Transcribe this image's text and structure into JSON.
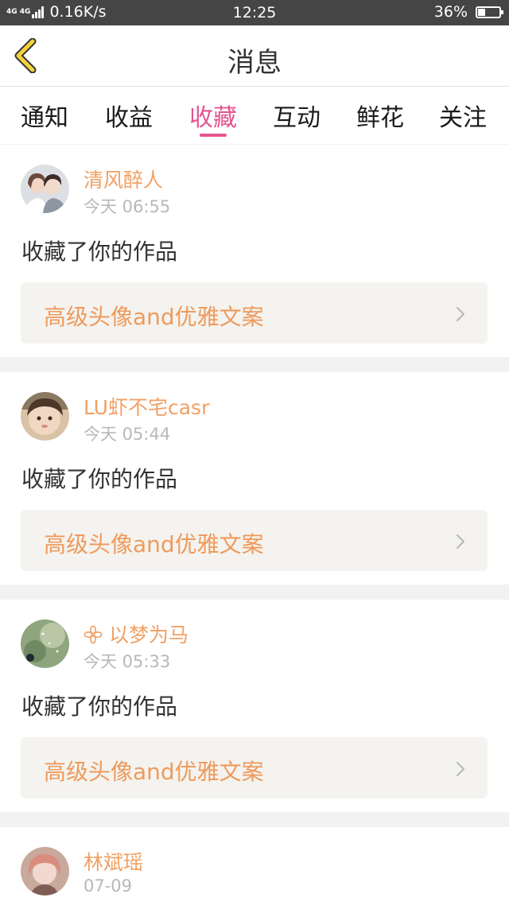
{
  "status_bar": {
    "network": "4G 4G",
    "speed": "0.16K/s",
    "time": "12:25",
    "battery": "36%",
    "battery_level": 0.36
  },
  "header": {
    "title": "消息",
    "back_icon": "chevron-left-icon",
    "accent_color": "#f2d23a"
  },
  "tabs": {
    "items": [
      {
        "label": "通知",
        "active": false
      },
      {
        "label": "收益",
        "active": false
      },
      {
        "label": "收藏",
        "active": true
      },
      {
        "label": "互动",
        "active": false
      },
      {
        "label": "鲜花",
        "active": false
      },
      {
        "label": "关注",
        "active": false
      }
    ],
    "active_color": "#e55591"
  },
  "notifications": [
    {
      "username": "清风醉人",
      "time": "今天 06:55",
      "action": "收藏了你的作品",
      "work_title": "高级头像and优雅文案"
    },
    {
      "username": "LU虾不宅casr",
      "time": "今天 05:44",
      "action": "收藏了你的作品",
      "work_title": "高级头像and优雅文案"
    },
    {
      "username": "以梦为马",
      "username_icon": "flower-icon",
      "time": "今天 05:33",
      "action": "收藏了你的作品",
      "work_title": "高级头像and优雅文案"
    },
    {
      "username": "林斌瑶",
      "time": "07-09"
    }
  ],
  "colors": {
    "username": "#f0a064",
    "work_title": "#ef9a5c",
    "work_box_bg": "#f4f3ef"
  }
}
